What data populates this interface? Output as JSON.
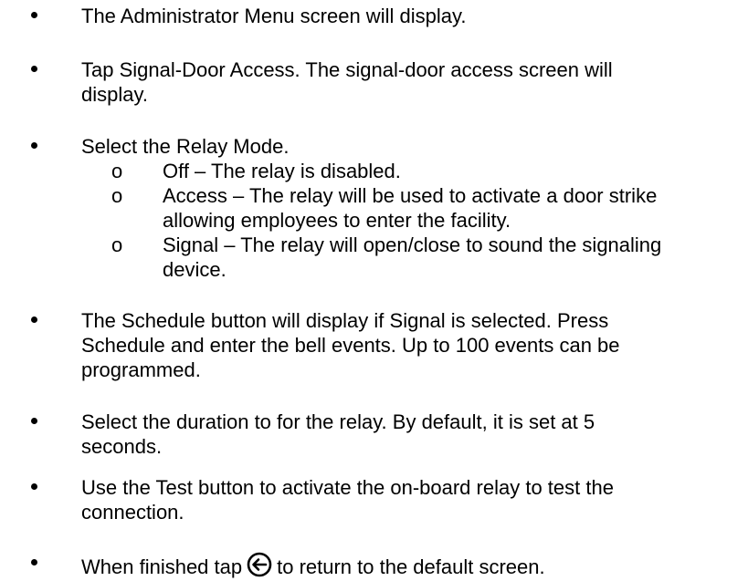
{
  "bullets": [
    {
      "text": "The Administrator Menu screen will display."
    },
    {
      "text": "Tap Signal-Door Access. The signal-door access screen will\ndisplay."
    },
    {
      "text": "Select the Relay Mode."
    },
    {
      "text": "The Schedule button will display if Signal is selected. Press\nSchedule and enter the bell events. Up to 100 events can be\nprogrammed."
    },
    {
      "text": "Select the duration to for the relay. By default, it is set at 5\nseconds."
    },
    {
      "text": "Use the Test button to activate the on-board relay to test the\nconnection."
    },
    {
      "text_before": "When finished tap",
      "icon": "back-arrow-circle-icon",
      "text_after": "to return to the default screen."
    }
  ],
  "sub_bullets": [
    {
      "marker": "o",
      "text": "Off – The relay is disabled."
    },
    {
      "marker": "o",
      "text": "Access – The relay will be used to activate a door strike\nallowing employees to enter the facility."
    },
    {
      "marker": "o",
      "text": "Signal – The relay will open/close to sound the signaling\ndevice."
    }
  ]
}
